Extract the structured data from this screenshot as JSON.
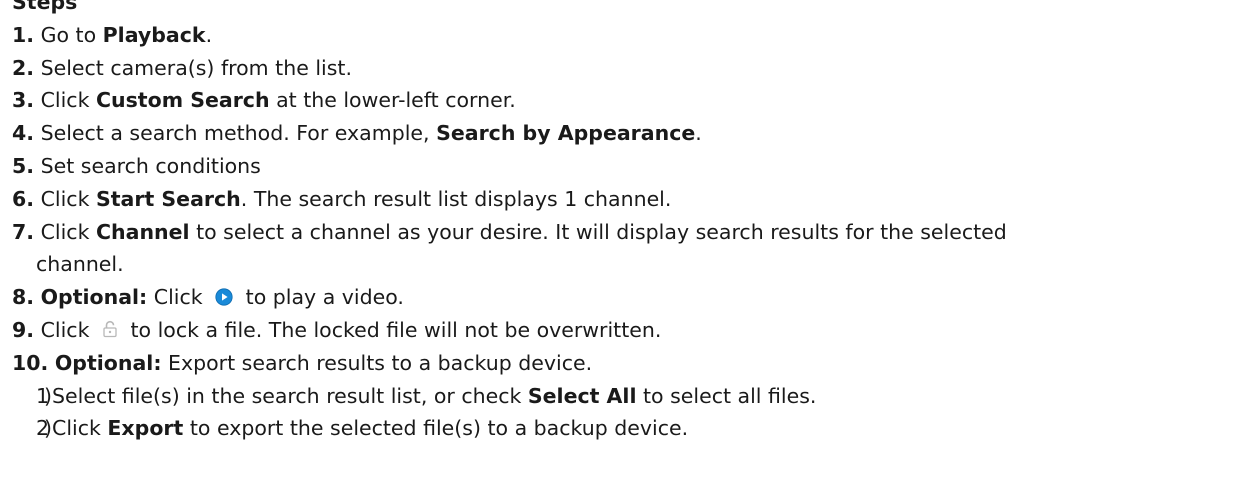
{
  "header": {
    "text": "Steps"
  },
  "steps": [
    {
      "num": "1.",
      "t1": "Go to ",
      "b1": "Playback",
      "t2": "."
    },
    {
      "num": "2.",
      "t1": "Select camera(s) from the list."
    },
    {
      "num": "3.",
      "t1": "Click ",
      "b1": "Custom Search",
      "t2": " at the lower-left corner."
    },
    {
      "num": "4.",
      "t1": "Select a search method. For example, ",
      "b1": "Search by Appearance",
      "t2": "."
    },
    {
      "num": "5.",
      "t1": "Set search conditions"
    },
    {
      "num": "6.",
      "t1": "Click ",
      "b1": "Start Search",
      "t2": ". The search result list displays 1 channel."
    },
    {
      "num": "7.",
      "t1": "Click ",
      "b1": "Channel",
      "t2": " to select a channel as your desire. It will display search results for the selected",
      "t3": "channel."
    },
    {
      "num": "8.",
      "b0": "Optional:",
      "t1": " Click ",
      "icon": "play-icon",
      "t2": " to play a video."
    },
    {
      "num": "9.",
      "t1": "Click ",
      "icon": "lock-icon",
      "t2": " to lock a file. The locked file will not be overwritten."
    },
    {
      "num": "10.",
      "b0": "Optional:",
      "t1": " Export search results to a backup device."
    }
  ],
  "substeps": [
    {
      "num": "1)",
      "t1": "Select file(s) in the search result list, or check ",
      "b1": "Select All",
      "t2": " to select all files."
    },
    {
      "num": "2)",
      "t1": "Click ",
      "b1": "Export",
      "t2": " to export the selected file(s) to a backup device."
    }
  ],
  "colors": {
    "text": "#1a1a1a",
    "play_icon": "#1a8ad8",
    "lock_icon": "#b8b8b8"
  }
}
